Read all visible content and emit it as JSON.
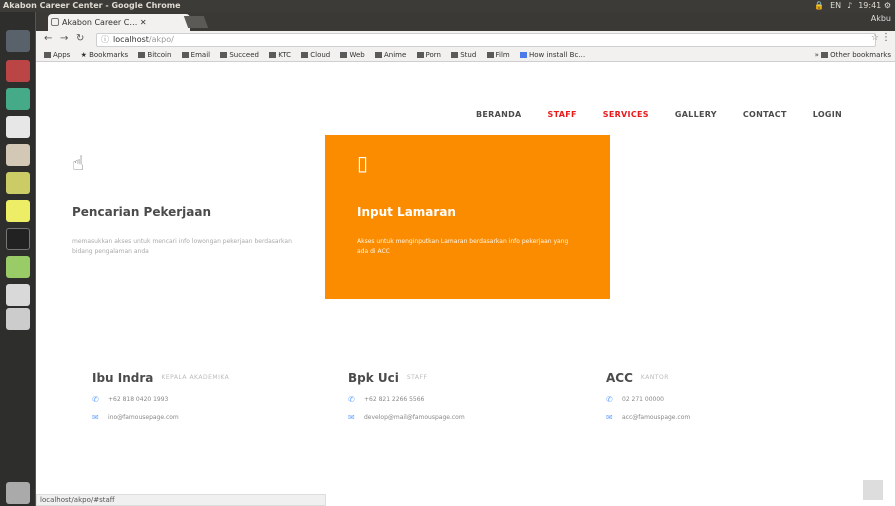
{
  "window": {
    "title": "Akabon Career Center - Google Chrome"
  },
  "tray": [
    "🔒",
    "EN",
    "♪",
    "19:41 ⚙"
  ],
  "tab": {
    "label": "Akabon Career C… ✕"
  },
  "address": {
    "host": "localhost",
    "path": "/akpo/"
  },
  "bookmarks": [
    "Apps",
    "Bookmarks",
    "Bitcoin",
    "Email",
    "Succeed",
    "KTC",
    "Cloud",
    "Web",
    "Anime",
    "Porn",
    "Stud",
    "Film",
    "How install Bc…"
  ],
  "bookmarks_right": "Other bookmarks",
  "nav": {
    "items": [
      "BERANDA",
      "STAFF",
      "SERVICES",
      "GALLERY",
      "CONTACT",
      "LOGIN"
    ]
  },
  "cards": [
    {
      "title": "Pencarian Pekerjaan",
      "desc": "memasukkan akses untuk mencari info lowongan pekerjaan berdasarkan bidang pengalaman anda",
      "icon": "bulb"
    },
    {
      "title": "Input Lamaran",
      "desc": "Akses untuk menginputkan Lamaran berdasarkan info pekerjaan yang ada di ACC",
      "icon": "document"
    }
  ],
  "contacts": [
    {
      "name": "Ibu Indra",
      "role": "KEPALA AKADEMIKA",
      "phone": "+62 818 0420 1993",
      "email": "ino@famousepage.com"
    },
    {
      "name": "Bpk Uci",
      "role": "STAFF",
      "phone": "+62 821 2266 5566",
      "email": "develop@mail@famouspage.com"
    },
    {
      "name": "ACC",
      "role": "KANTOR",
      "phone": "02 271 00000",
      "email": "acc@famouspage.com"
    }
  ],
  "status": {
    "url": "localhost/akpo/#staff"
  }
}
